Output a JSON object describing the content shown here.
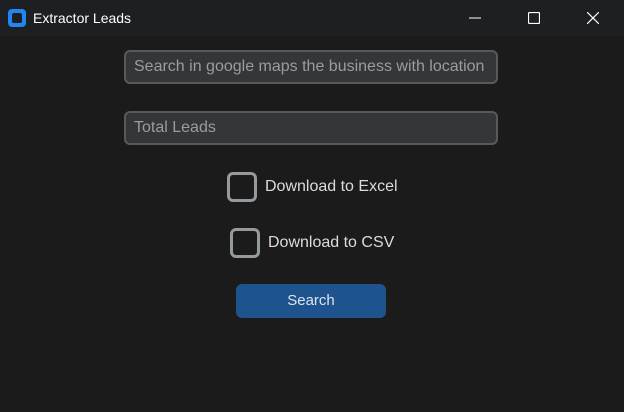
{
  "window": {
    "title": "Extractor Leads",
    "icon": "app-logo-icon",
    "controls": {
      "minimize": "minimize-icon",
      "maximize": "maximize-icon",
      "close": "close-icon"
    }
  },
  "form": {
    "search": {
      "placeholder": "Search in google maps the business with location",
      "value": ""
    },
    "total_leads": {
      "placeholder": "Total Leads",
      "value": ""
    },
    "download_excel": {
      "label": "Download to Excel",
      "checked": false
    },
    "download_csv": {
      "label": "Download to CSV",
      "checked": false
    },
    "search_button_label": "Search"
  },
  "colors": {
    "background": "#1b1b1b",
    "titlebar": "#1e1f22",
    "input_bg": "#343638",
    "input_border": "#575a5c",
    "checkbox_border": "#949a9e",
    "button": "#1f538d",
    "accent_icon": "#1f86f2"
  }
}
